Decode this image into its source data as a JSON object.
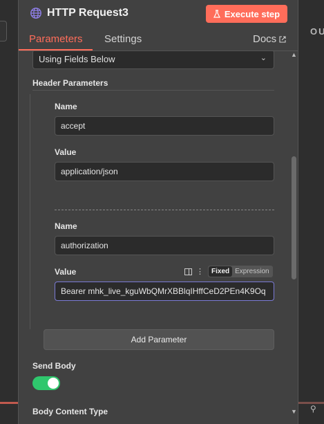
{
  "node": {
    "title": "HTTP Request3",
    "icon": "globe-icon"
  },
  "header": {
    "execute_label": "Execute step"
  },
  "tabs": {
    "parameters": "Parameters",
    "settings": "Settings",
    "docs": "Docs"
  },
  "specify_headers": {
    "value": "Using Fields Below"
  },
  "header_parameters": {
    "title": "Header Parameters",
    "items": [
      {
        "name_label": "Name",
        "name_value": "accept",
        "value_label": "Value",
        "value_value": "application/json"
      },
      {
        "name_label": "Name",
        "name_value": "authorization",
        "value_label": "Value",
        "value_value": "Bearer mhk_live_kguWbQMrXBBlqIHffCeD2PEn4K9Oq"
      }
    ],
    "mode": {
      "fixed": "Fixed",
      "expression": "Expression"
    },
    "add_label": "Add Parameter"
  },
  "send_body": {
    "label": "Send Body",
    "enabled": true
  },
  "body_content_type": {
    "label": "Body Content Type"
  },
  "background": {
    "output_peek": "OU"
  },
  "colors": {
    "accent": "#ff6d5a",
    "toggle_on": "#2fc76d",
    "panel": "#414141"
  }
}
